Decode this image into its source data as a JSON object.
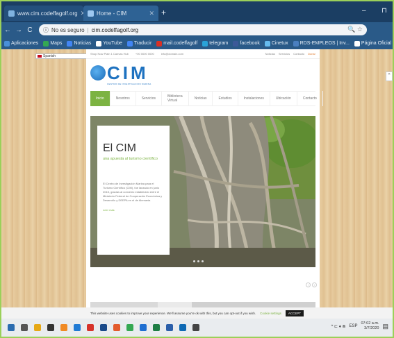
{
  "browser": {
    "tabs": [
      {
        "label": "www.cim.codeffagolf.org",
        "active": false
      },
      {
        "label": "Home - CIM",
        "active": true
      }
    ],
    "new_tab": "+",
    "window_controls": {
      "minimize": "–",
      "restore": "⊓"
    },
    "nav": {
      "back": "←",
      "forward": "→",
      "reload": "C"
    },
    "address": {
      "info_icon": "ⓘ",
      "security_label": "No es seguro",
      "separator": "|",
      "url": "cim.codeffagolf.org"
    },
    "omnibox_actions": "🔍 ☆",
    "bookmarks": [
      {
        "label": "Aplicaciones",
        "icon_color": "#4a90d9"
      },
      {
        "label": "Maps",
        "icon_color": "#34a853"
      },
      {
        "label": "Noticias",
        "icon_color": "#4285f4"
      },
      {
        "label": "YouTube",
        "icon_color": "#ffffff"
      },
      {
        "label": "Traducir",
        "icon_color": "#4285f4"
      },
      {
        "label": "mail.codeffagolf",
        "icon_color": "#d93025"
      },
      {
        "label": "telegram",
        "icon_color": "#2aa3d8"
      },
      {
        "label": "facebook",
        "icon_color": "#3b5998"
      },
      {
        "label": "Cinetux",
        "icon_color": "#66bbee"
      },
      {
        "label": "RDS-EMPLEOS | Inv...",
        "icon_color": "#4a7fc0"
      },
      {
        "label": "Página Oficial De S...",
        "icon_color": "#ffffff"
      }
    ]
  },
  "page": {
    "language": "Spanish",
    "side_widget": "«",
    "topbar": {
      "contacts": [
        "Shop Now Plain 1 Canvas Hub",
        "+00 0000 0000",
        "info@domain.com"
      ],
      "links": [
        "Noticias",
        "Servicios",
        "Contacto",
        "Donar"
      ]
    },
    "logo": {
      "text": "CIM",
      "subtitle": "CENTRO DE INVESTIGACION MARINA"
    },
    "menu": [
      "Inicio",
      "Nosotros",
      "Servicios",
      "Biblioteca Virtual",
      "Noticias",
      "Estudios",
      "Instalaciones",
      "Ubicación",
      "Contacto"
    ],
    "hero": {
      "title": "El CIM",
      "tagline": "una apuesta al turismo científico",
      "body": "El Centro de Investigación Marina para el Turismo Científico (CIM), fue lanzado en junio 2015, gracias al convenio establecido entre el Ministerio Federal de Cooperación Económica y Desarrollo y DEEPA en el de Alemania",
      "more_link": "Leer más"
    },
    "slider_arrows": [
      "‹",
      "›"
    ],
    "cookie_bar": {
      "text": "This website uses cookies to improve your experience. We'll assume you're ok with this, but you can opt-out if you wish.",
      "settings": "Cookie settings",
      "accept": "ACCEPT"
    }
  },
  "taskbar": {
    "icons": [
      {
        "name": "windows-start-icon",
        "color": "#2b6cb0"
      },
      {
        "name": "search-icon",
        "color": "#555555"
      },
      {
        "name": "file-explorer-icon",
        "color": "#e6a817"
      },
      {
        "name": "store-icon",
        "color": "#333333"
      },
      {
        "name": "vlc-icon",
        "color": "#f08a24"
      },
      {
        "name": "edge-icon",
        "color": "#1f7ad4"
      },
      {
        "name": "opera-icon",
        "color": "#d6332b"
      },
      {
        "name": "firefox-icon",
        "color": "#1a4a8a"
      },
      {
        "name": "paint-icon",
        "color": "#e35b2d"
      },
      {
        "name": "chrome-icon",
        "color": "#34a853"
      },
      {
        "name": "outlook-icon",
        "color": "#1f6fd1"
      },
      {
        "name": "excel-icon",
        "color": "#1e7e45"
      },
      {
        "name": "word-icon",
        "color": "#2b5faa"
      },
      {
        "name": "mail-icon",
        "color": "#0f6ab4"
      },
      {
        "name": "calculator-icon",
        "color": "#444444"
      }
    ],
    "tray": {
      "indicators": "^ ⊏ ♦ ⋒",
      "language": "ESP",
      "time": "07:02 a.m.",
      "date": "3/7/2020"
    }
  }
}
